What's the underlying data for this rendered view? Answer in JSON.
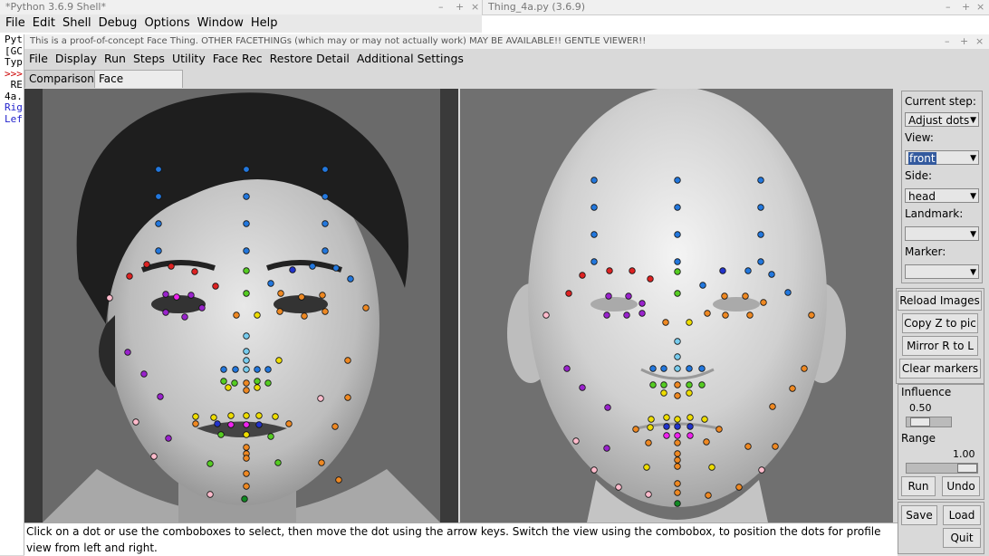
{
  "shell": {
    "title": "*Python 3.6.9 Shell*",
    "menu": [
      "File",
      "Edit",
      "Shell",
      "Debug",
      "Options",
      "Window",
      "Help"
    ],
    "lines": [
      "Pyt",
      "[GC",
      "Typ",
      ">>>",
      " RE",
      "4a.",
      "Rig",
      "Lef"
    ]
  },
  "editor": {
    "title": "Thing_4a.py (3.6.9)"
  },
  "app": {
    "title": "This is a proof-of-concept Face Thing.  OTHER FACETHINGs (which may or may not actually work) MAY BE AVAILABLE!!  GENTLE VIEWER!!",
    "menu": [
      "File",
      "Display",
      "Run",
      "Steps",
      "Utility",
      "Face Rec",
      "Restore Detail",
      "Additional Settings"
    ],
    "tabs": [
      "Comparisons",
      "Face Recognition"
    ],
    "status": "Click on a dot or use the comboboxes to select, then move the dot using the arrow keys. Switch the view using the combobox, to position the dots for profile view from left and right."
  },
  "controls": {
    "current_step_label": "Current step:",
    "current_step_value": "Adjust dots",
    "view_label": "View:",
    "view_value": "front",
    "side_label": "Side:",
    "side_value": "head",
    "landmark_label": "Landmark:",
    "landmark_value": "",
    "marker_label": "Marker:",
    "marker_value": "",
    "reload_images": "Reload Images",
    "copy_z": "Copy Z to pic",
    "mirror": "Mirror R to L",
    "clear_markers": "Clear markers",
    "influence_label": "Influence",
    "influence_value": "0.50",
    "range_label": "Range",
    "range_value": "1.00",
    "run": "Run",
    "undo": "Undo",
    "save": "Save",
    "load": "Load",
    "quit": "Quit"
  },
  "colors": {
    "blue": "#2277dd",
    "red": "#dd2222",
    "green": "#55cc22",
    "yellow": "#eedd00",
    "orange": "#ee8822",
    "purple": "#9922cc",
    "pink": "#ffbbcc",
    "cyan": "#77ccee",
    "magenta": "#ee22ee",
    "darkblue": "#2233cc",
    "darkgreen": "#118822"
  }
}
